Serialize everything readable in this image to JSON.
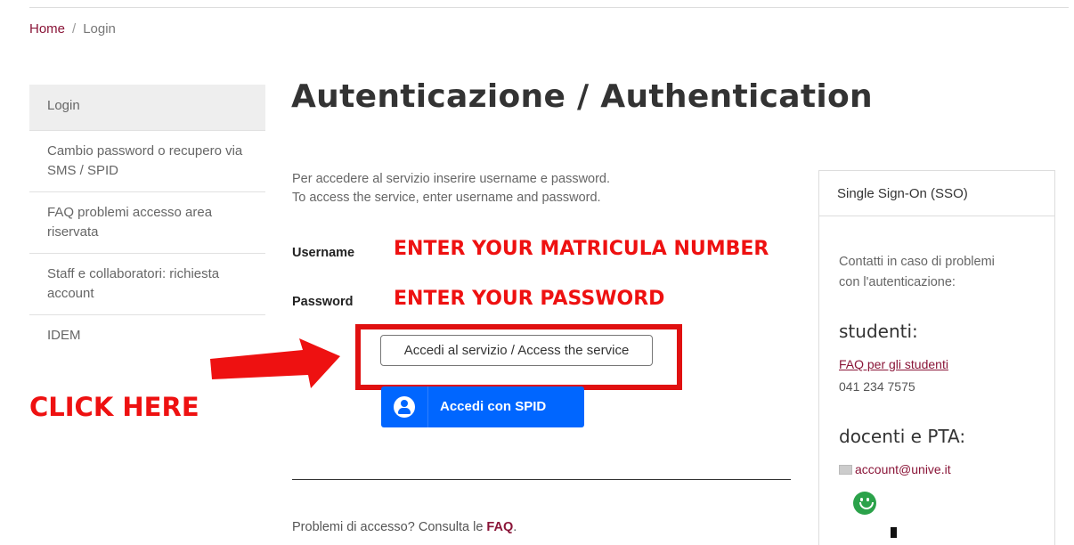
{
  "breadcrumb": {
    "home": "Home",
    "separator": "/",
    "current": "Login"
  },
  "sidebar": {
    "items": [
      {
        "label": "Login",
        "active": true
      },
      {
        "label": "Cambio password o recupero via SMS / SPID"
      },
      {
        "label": "FAQ problemi accesso area riservata"
      },
      {
        "label": "Staff e collaboratori: richiesta account"
      },
      {
        "label": "IDEM"
      }
    ]
  },
  "main": {
    "title": "Autenticazione / Authentication",
    "intro_it": "Per accedere al servizio inserire username e password.",
    "intro_en": "To access the service, enter username and password.",
    "username_label": "Username",
    "password_label": "Password",
    "access_button": "Accedi al servizio / Access the service",
    "spid_button": "Accedi con SPID",
    "problems_text": "Problemi di accesso? Consulta le",
    "problems_link": "FAQ",
    "problems_end": "."
  },
  "annotations": {
    "username_hint": "ENTER YOUR MATRICULA NUMBER",
    "password_hint": "ENTER YOUR PASSWORD",
    "click_hint": "CLICK HERE",
    "accent_color": "#e01010"
  },
  "sso_panel": {
    "title": "Single Sign-On (SSO)",
    "contact_line1": "Contatti in caso di problemi",
    "contact_line2": "con l'autenticazione:",
    "students_heading": "studenti:",
    "students_faq": "FAQ per gli studenti",
    "students_phone": "041 234 7575",
    "staff_heading": "docenti e PTA:",
    "staff_email": "account@unive.it"
  },
  "colors": {
    "link": "#8a1538",
    "spid": "#0066ff"
  }
}
